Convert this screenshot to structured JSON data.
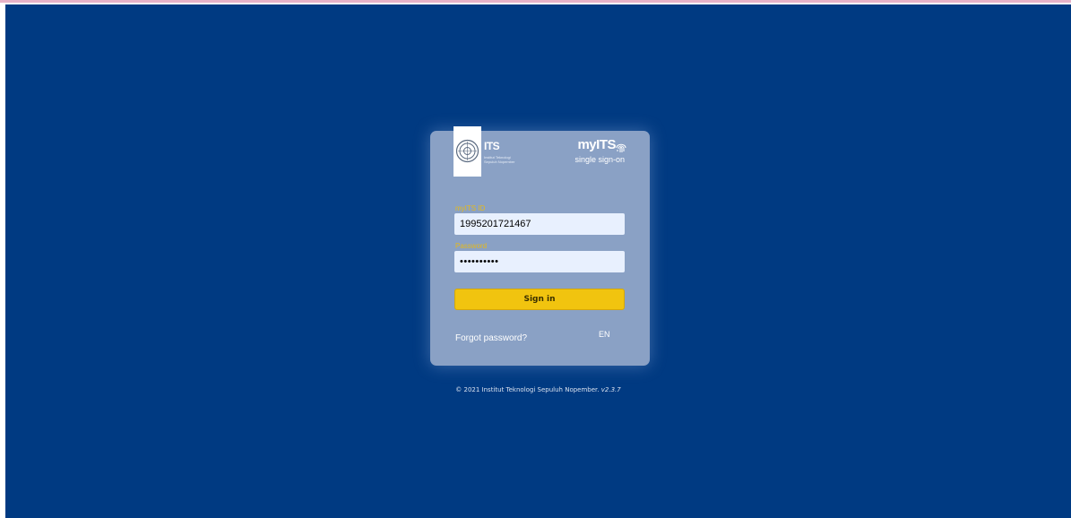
{
  "logo": {
    "wordmark": "ITS",
    "subtitle": "Institut Teknologi Sepuluh Nopember"
  },
  "brand": {
    "name_prefix": "my",
    "name_main": "ITS",
    "tagline": "single sign-on"
  },
  "form": {
    "username_label": "myITS ID",
    "username_value": "1995201721467",
    "password_label": "Password",
    "password_value": "••••••••••",
    "signin_label": "Sign in",
    "forgot_label": "Forgot password?",
    "language": "EN"
  },
  "footer": {
    "copyright": "© 2021 Institut Teknologi Sepuluh Nopember.",
    "version": "v2.3.7"
  },
  "colors": {
    "background": "#003a82",
    "card": "#8aa1c5",
    "accent": "#f1c40f",
    "label": "#e5b91a"
  },
  "icons": [
    "its-seal-icon",
    "fingerprint-icon"
  ]
}
